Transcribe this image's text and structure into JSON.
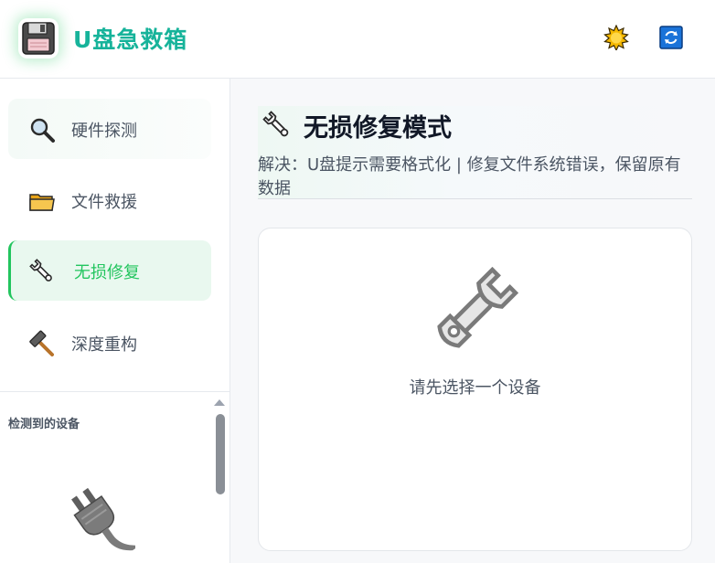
{
  "app": {
    "title": "U盘急救箱",
    "logo_icon": "floppy-disk-icon",
    "theme_toggle_icon": "sun-icon",
    "refresh_icon": "refresh-icon"
  },
  "sidebar": {
    "items": [
      {
        "label": "硬件探测",
        "icon": "magnifier-icon",
        "state": "hover"
      },
      {
        "label": "文件救援",
        "icon": "folder-icon",
        "state": "normal"
      },
      {
        "label": "无损修复",
        "icon": "wrench-icon",
        "state": "active"
      },
      {
        "label": "深度重构",
        "icon": "hammer-icon",
        "state": "normal"
      }
    ],
    "devices": {
      "title": "检测到的设备",
      "empty_icon": "usb-plug-icon"
    }
  },
  "main": {
    "mode_title": "无损修复模式",
    "mode_description": "解决：U盘提示需要格式化 | 修复文件系统错误，保留原有数据",
    "empty_state": {
      "icon": "wrench-icon",
      "hint": "请先选择一个设备"
    }
  },
  "colors": {
    "accent": "#22c55e",
    "brand_title": "#16b39a",
    "active_bg": "#e9f8ef",
    "text_muted": "#4b5563",
    "main_bg": "#f7f8fa"
  }
}
